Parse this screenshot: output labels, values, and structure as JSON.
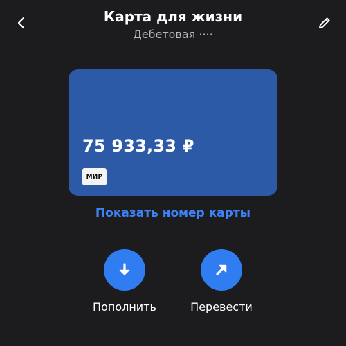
{
  "header": {
    "title": "Карта для жизни",
    "subtitle": "Дебетовая ····"
  },
  "card": {
    "balance": "75 933,33 ₽",
    "payment_system": "МИР",
    "color": "#2c5aa6"
  },
  "show_number_label": "Показать номер карты",
  "actions": {
    "topup_label": "Пополнить",
    "transfer_label": "Перевести"
  },
  "icons": {
    "back": "chevron-left-icon",
    "edit": "pencil-icon",
    "topup": "arrow-down-icon",
    "transfer": "arrow-up-right-icon"
  },
  "colors": {
    "background": "#1c1c1f",
    "accent": "#2f7df0",
    "link": "#3d82f6"
  }
}
